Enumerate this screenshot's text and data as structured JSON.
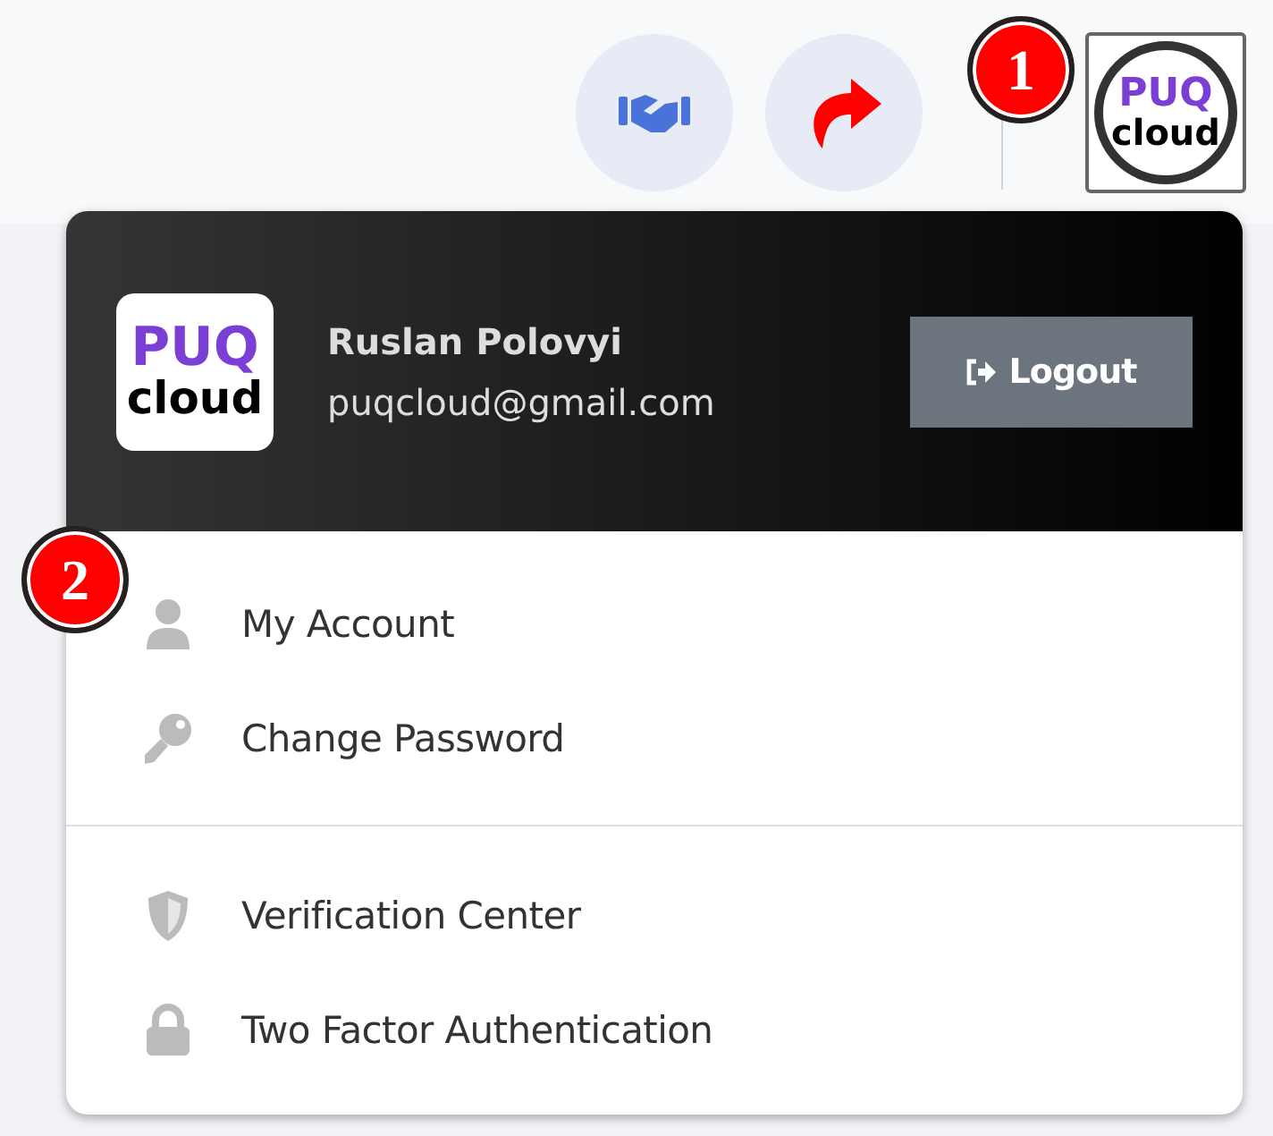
{
  "top_bar": {
    "buttons": [
      {
        "kind": "handshake"
      },
      {
        "kind": "redirect"
      }
    ],
    "avatar": {
      "logo_top": "PUQ",
      "logo_bottom": "cloud"
    }
  },
  "annotations": [
    {
      "text": "1",
      "kind": "avatar"
    },
    {
      "text": "2",
      "kind": "menu"
    }
  ],
  "user_menu": {
    "logo": {
      "top": "PUQ",
      "bottom": "cloud"
    },
    "name": "Ruslan Polovyi",
    "email": "puqcloud@gmail.com",
    "logout": "Logout",
    "groups": [
      {
        "items": [
          {
            "kind": "user",
            "label": "My Account"
          },
          {
            "kind": "key",
            "label": "Change Password"
          }
        ]
      },
      {
        "items": [
          {
            "kind": "shield",
            "label": "Verification Center"
          },
          {
            "kind": "lock",
            "label": "Two Factor Authentication"
          }
        ]
      }
    ]
  }
}
